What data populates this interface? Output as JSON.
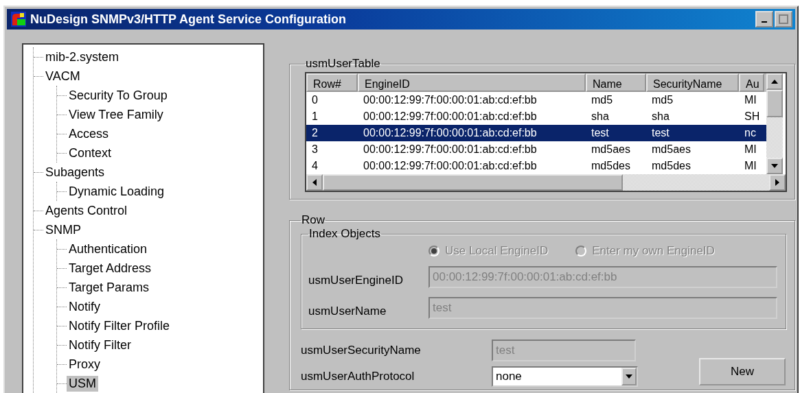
{
  "window": {
    "title": "NuDesign SNMPv3/HTTP Agent Service Configuration"
  },
  "tree": [
    {
      "label": "mib-2.system",
      "selected": false
    },
    {
      "label": "VACM",
      "selected": false,
      "children": [
        {
          "label": "Security To Group",
          "selected": false
        },
        {
          "label": "View Tree Family",
          "selected": false
        },
        {
          "label": "Access",
          "selected": false
        },
        {
          "label": "Context",
          "selected": false
        }
      ]
    },
    {
      "label": "Subagents",
      "selected": false,
      "children": [
        {
          "label": "Dynamic Loading",
          "selected": false
        }
      ]
    },
    {
      "label": "Agents Control",
      "selected": false
    },
    {
      "label": "SNMP",
      "selected": false,
      "children": [
        {
          "label": "Authentication",
          "selected": false
        },
        {
          "label": "Target Address",
          "selected": false
        },
        {
          "label": "Target Params",
          "selected": false
        },
        {
          "label": "Notify",
          "selected": false
        },
        {
          "label": "Notify Filter Profile",
          "selected": false
        },
        {
          "label": "Notify Filter",
          "selected": false
        },
        {
          "label": "Proxy",
          "selected": false
        },
        {
          "label": "USM",
          "selected": true
        }
      ]
    }
  ],
  "user_table": {
    "title": "usmUserTable",
    "columns": [
      "Row#",
      "EngineID",
      "Name",
      "SecurityName",
      "Au"
    ],
    "rows": [
      {
        "cells": [
          "0",
          "00:00:12:99:7f:00:00:01:ab:cd:ef:bb",
          "md5",
          "md5",
          "MI"
        ],
        "selected": false
      },
      {
        "cells": [
          "1",
          "00:00:12:99:7f:00:00:01:ab:cd:ef:bb",
          "sha",
          "sha",
          "SH"
        ],
        "selected": false
      },
      {
        "cells": [
          "2",
          "00:00:12:99:7f:00:00:01:ab:cd:ef:bb",
          "test",
          "test",
          "nc"
        ],
        "selected": true
      },
      {
        "cells": [
          "3",
          "00:00:12:99:7f:00:00:01:ab:cd:ef:bb",
          "md5aes",
          "md5aes",
          "MI"
        ],
        "selected": false
      },
      {
        "cells": [
          "4",
          "00:00:12:99:7f:00:00:01:ab:cd:ef:bb",
          "md5des",
          "md5des",
          "MI"
        ],
        "selected": false
      }
    ]
  },
  "row_panel": {
    "title": "Row",
    "index_objects": {
      "title": "Index Objects",
      "radios": [
        {
          "label": "Use Local EngineID",
          "selected": true,
          "disabled": true
        },
        {
          "label": "Enter my own EngineID",
          "selected": false,
          "disabled": true
        }
      ],
      "fields": [
        {
          "label": "usmUserEngineID",
          "value": "00:00:12:99:7f:00:00:01:ab:cd:ef:bb",
          "disabled": true
        },
        {
          "label": "usmUserName",
          "value": "test",
          "disabled": true
        }
      ]
    },
    "fields": [
      {
        "kind": "text",
        "label": "usmUserSecurityName",
        "value": "test",
        "disabled": true
      },
      {
        "kind": "select",
        "label": "usmUserAuthProtocol",
        "value": "none",
        "disabled": false
      }
    ],
    "buttons": [
      "New"
    ]
  }
}
